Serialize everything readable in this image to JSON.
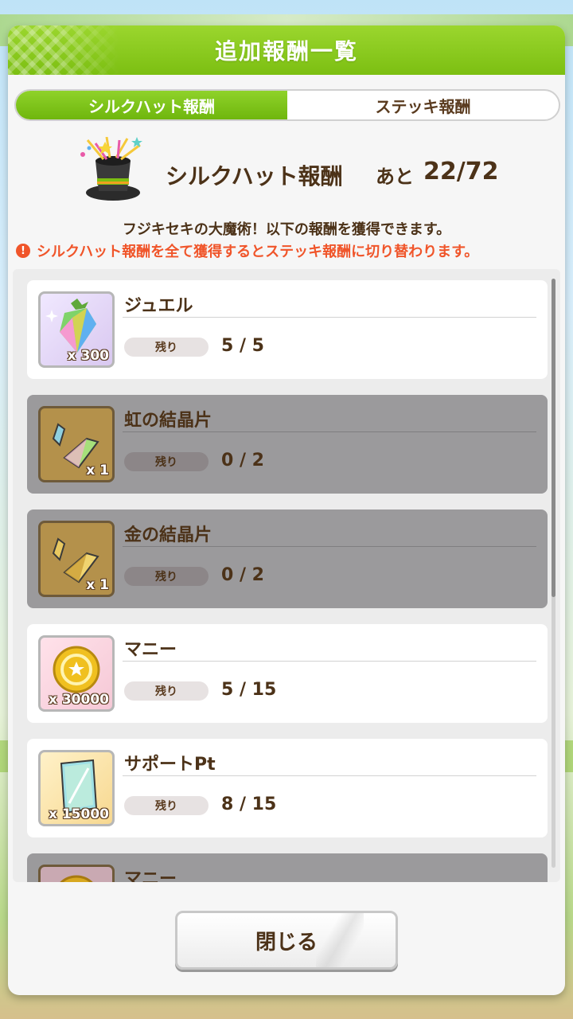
{
  "header": {
    "title": "追加報酬一覧"
  },
  "tabs": [
    {
      "label": "シルクハット報酬",
      "active": true
    },
    {
      "label": "ステッキ報酬",
      "active": false
    }
  ],
  "summary": {
    "title": "シルクハット報酬",
    "remaining_prefix": "あと",
    "remaining_count": "22/72",
    "icon": "silk-hat-icon"
  },
  "description": "フジキセキの大魔術！以下の報酬を獲得できます。",
  "warning": {
    "icon": "!",
    "text": "シルクハット報酬を全て獲得するとステッキ報酬に切り替わります。"
  },
  "rewards": [
    {
      "name": "ジュエル",
      "quantity": "x 300",
      "remaining_label": "残り",
      "remaining": "5 / 5",
      "exhausted": false,
      "icon": "jewel-icon"
    },
    {
      "name": "虹の結晶片",
      "quantity": "x 1",
      "remaining_label": "残り",
      "remaining": "0 / 2",
      "exhausted": true,
      "icon": "rainbow-crystal-icon"
    },
    {
      "name": "金の結晶片",
      "quantity": "x 1",
      "remaining_label": "残り",
      "remaining": "0 / 2",
      "exhausted": true,
      "icon": "gold-crystal-icon"
    },
    {
      "name": "マニー",
      "quantity": "x 30000",
      "remaining_label": "残り",
      "remaining": "5 / 15",
      "exhausted": false,
      "icon": "money-coin-icon"
    },
    {
      "name": "サポートPt",
      "quantity": "x 15000",
      "remaining_label": "残り",
      "remaining": "8 / 15",
      "exhausted": false,
      "icon": "support-pt-icon"
    },
    {
      "name": "マニー",
      "quantity": "",
      "remaining_label": "",
      "remaining": "",
      "exhausted": true,
      "icon": "money-coin-icon"
    }
  ],
  "close_button": {
    "label": "閉じる"
  },
  "colors": {
    "accent_green": "#7cbf12",
    "text_brown": "#4c3218",
    "warning": "#f0552a",
    "exhausted_gray": "#9b9a9c"
  }
}
